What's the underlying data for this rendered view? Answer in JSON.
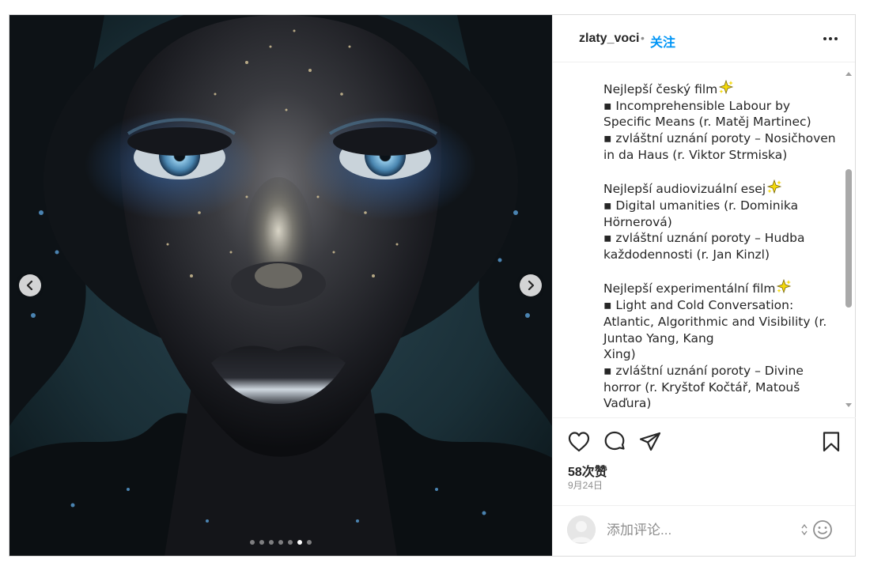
{
  "header": {
    "username": "zlaty_voci",
    "separator": "•",
    "follow_label": "关注",
    "more_icon": "more-horizontal-icon"
  },
  "caption_lines": [
    {
      "text": "Nejlepší český film",
      "sparkle": true
    },
    {
      "text": "▪ Incomprehensible Labour by"
    },
    {
      "text": "Specific Means (r. Matěj Martinec)"
    },
    {
      "text": "▪ zvláštní uznání poroty – Nosičhoven"
    },
    {
      "text": "in da Haus (r. Viktor Strmiska)"
    },
    {
      "text": "",
      "gap": true
    },
    {
      "text": "Nejlepší audiovizuální esej",
      "sparkle": true
    },
    {
      "text": "▪ Digital umanities (r. Dominika"
    },
    {
      "text": "Hörnerová)"
    },
    {
      "text": "▪ zvláštní uznání poroty – Hudba"
    },
    {
      "text": "každodennosti (r. Jan Kinzl)"
    },
    {
      "text": "",
      "gap": true
    },
    {
      "text": "Nejlepší experimentální film",
      "sparkle": true
    },
    {
      "text": "▪ Light and Cold Conversation:"
    },
    {
      "text": "Atlantic, Algorithmic and Visibility (r."
    },
    {
      "text": "Juntao Yang, Kang"
    },
    {
      "text": "Xing)"
    },
    {
      "text": "▪ zvláštní uznání poroty – Divine"
    },
    {
      "text": "horror (r. Kryštof Kočtář, Matouš"
    },
    {
      "text": "Vaďura)"
    }
  ],
  "carousel": {
    "total_slides": 7,
    "active_slide": 6
  },
  "actions": {
    "like_icon": "heart-icon",
    "comment_icon": "comment-icon",
    "share_icon": "send-icon",
    "save_icon": "bookmark-icon"
  },
  "likes_label": "58次赞",
  "date_label": "9月24日",
  "comment": {
    "placeholder": "添加评论..."
  },
  "colors": {
    "accent": "#0095f6",
    "text": "#262626",
    "muted": "#8e8e8e",
    "sparkle": "#f5d90a"
  }
}
